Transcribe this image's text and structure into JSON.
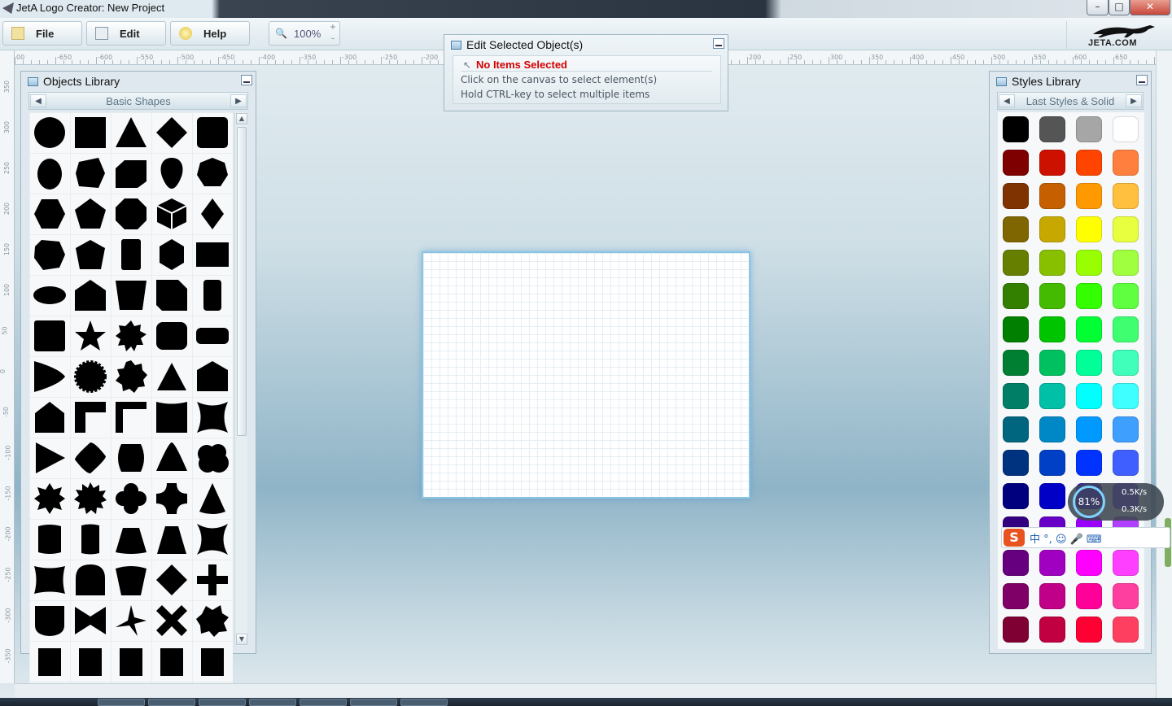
{
  "window": {
    "title": "JetA Logo Creator: New Project",
    "minimize": "–",
    "maximize": "□",
    "close": "✕"
  },
  "toolbar": {
    "file": "File",
    "edit": "Edit",
    "help": "Help",
    "zoom": "100%",
    "zoom_up": "+",
    "zoom_down": "–",
    "brand": "JETA.COM"
  },
  "edit_panel": {
    "title": "Edit Selected Object(s)",
    "status": "No Items Selected",
    "hint1": "Click on the canvas to select element(s)",
    "hint2": "Hold CTRL-key to select multiple items"
  },
  "objects_panel": {
    "title": "Objects Library",
    "category": "Basic Shapes"
  },
  "styles_panel": {
    "title": "Styles Library",
    "category": "Last Styles & Solid"
  },
  "ruler_top": [
    "00",
    "-650",
    "-600",
    "-550",
    "-500",
    "-450",
    "-400",
    "-350",
    "-300",
    "-250",
    "-200",
    "200",
    "250",
    "300",
    "350",
    "400",
    "450",
    "500",
    "550",
    "600",
    "650"
  ],
  "ruler_left": [
    "350",
    "300",
    "250",
    "200",
    "150",
    "100",
    "50",
    "0",
    "-50",
    "-100",
    "-150",
    "-200",
    "-250",
    "-300",
    "-350"
  ],
  "shapes": [
    "circle",
    "square",
    "triangle",
    "diamond",
    "rounded-square",
    "egg",
    "pentagon-tilted",
    "parallelogram-rounded",
    "drop",
    "heptagon",
    "hexagon",
    "pentagon",
    "octagon",
    "cube",
    "rhombus-tall",
    "heptagon-2",
    "pentagon-2",
    "rounded-rect-tall",
    "hexagon-tall",
    "rectangle",
    "ellipse",
    "house",
    "trapezoid",
    "folded-corner",
    "pill-tall",
    "rounded-square-2",
    "star-5",
    "star-8",
    "rounded-square-3",
    "pill",
    "shield-half",
    "seal",
    "starburst",
    "triangle-2",
    "pentagon-house",
    "pentagon-house-2",
    "corner-bracket",
    "corner-bracket-2",
    "curved-square",
    "concave-square",
    "play-triangle",
    "rounded-diamond",
    "circle-flat",
    "rounded-triangle",
    "cloud",
    "star-8-b",
    "star-12",
    "flower",
    "cross-rounded",
    "cone",
    "cylinder",
    "cylinder-2",
    "trapezoid-2",
    "trapezoid-3",
    "concave-square-2",
    "concave-square-3",
    "arch",
    "pentagon-3",
    "diamond-2",
    "plus",
    "shield",
    "bowtie",
    "pinwheel",
    "x-cross",
    "starburst-2"
  ],
  "swatches": [
    "#000000",
    "#555555",
    "#a6a6a6",
    "#ffffff",
    "#7f0000",
    "#cc1100",
    "#ff4400",
    "#ff7f3f",
    "#7f3300",
    "#c65f00",
    "#ff9900",
    "#ffbf3f",
    "#7f6600",
    "#c6a800",
    "#ffff00",
    "#e8ff3f",
    "#667f00",
    "#88c000",
    "#99ff00",
    "#a0ff3f",
    "#337f00",
    "#44bb00",
    "#33ff00",
    "#60ff3f",
    "#007f00",
    "#00c400",
    "#00ff33",
    "#3fff70",
    "#007f33",
    "#00c060",
    "#00ff99",
    "#3fffbb",
    "#007f66",
    "#00c0a8",
    "#00ffff",
    "#3fffff",
    "#00667f",
    "#0088c6",
    "#0099ff",
    "#3f9fff",
    "#00337f",
    "#0040c6",
    "#0033ff",
    "#3f60ff",
    "#00007f",
    "#0000c6",
    "#3300ff",
    "#703fff",
    "#33007f",
    "#6600c6",
    "#9900ff",
    "#b03fff",
    "#66007f",
    "#a000c0",
    "#ff00ff",
    "#ff3fff",
    "#7f0066",
    "#c00088",
    "#ff0099",
    "#ff3fa0",
    "#7f0033",
    "#c00040",
    "#ff0033",
    "#ff3f60"
  ],
  "ime": {
    "logo": "S",
    "items": "中 °, ☺ 🎤 ⌨"
  },
  "net": {
    "cpu": "81%",
    "down": "0.5K/s",
    "up": "0.3K/s"
  }
}
